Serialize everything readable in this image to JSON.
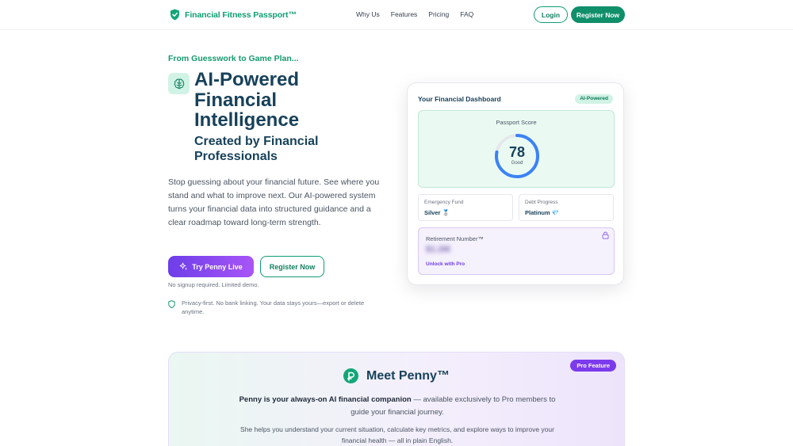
{
  "nav": {
    "brand": "Financial Fitness Passport™",
    "links": [
      "Why Us",
      "Features",
      "Pricing",
      "FAQ"
    ],
    "login": "Login",
    "register": "Register Now"
  },
  "hero": {
    "eyebrow": "From Guesswork to Game Plan...",
    "title": "AI-Powered Financial Intelligence",
    "subtitle": "Created by Financial Professionals",
    "description": "Stop guessing about your financial future. See where you stand and what to improve next. Our AI-powered system turns your financial data into structured guidance and a clear roadmap toward long-term strength.",
    "cta_primary": "Try Penny Live",
    "cta_secondary": "Register Now",
    "nosignup": "No signup required. Limited demo.",
    "privacy": "Privacy-first. No bank linking. Your data stays yours—export or delete anytime."
  },
  "dashboard": {
    "title": "Your Financial Dashboard",
    "badge": "AI-Powered",
    "score_label": "Passport Score",
    "score": 78,
    "score_max": 100,
    "score_display": "78",
    "score_word": "Good",
    "emergency_label": "Emergency Fund",
    "emergency_value": "Silver 🥈",
    "debt_label": "Debt Progress",
    "debt_value": "Platinum 💎",
    "retirement_label": "Retirement Number™",
    "retirement_value": "$1.2M",
    "retirement_unlock": "Unlock with Pro"
  },
  "penny": {
    "badge": "Pro Feature",
    "title": "Meet Penny™",
    "p1_bold": "Penny is your always-on AI financial companion",
    "p1_rest": " — available exclusively to Pro members to guide your financial journey.",
    "p2": "She helps you understand your current situation, calculate key metrics, and explore ways to improve your financial health — all in plain English."
  },
  "colors": {
    "brand_green": "#0f9d74",
    "heading_navy": "#17415a",
    "accent_purple": "#7c3aed",
    "gauge_blue": "#3b82f6"
  }
}
